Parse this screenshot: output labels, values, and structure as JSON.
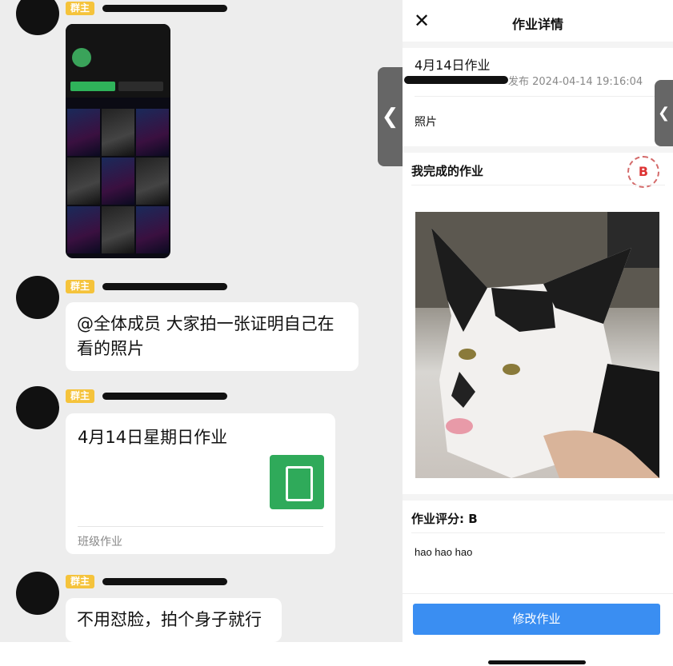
{
  "chat": {
    "tag_label": "群主",
    "message1": "@全体成员 大家拍一张证明自己在看的照片",
    "assignment_card": {
      "title": "4月14日星期日作业",
      "footer": "班级作业"
    },
    "message2": "不用怼脸，拍个身子就行"
  },
  "detail": {
    "nav_title": "作业详情",
    "close_icon": "close-icon",
    "hw_name": "4月14日作业",
    "publish_text": "发布 2024-04-14 19:16:04",
    "photo_label": "照片",
    "my_work_label": "我完成的作业",
    "grade_stamp": "B",
    "score_label": "作业评分: B",
    "comment": "hao hao hao",
    "edit_button": "修改作业"
  },
  "colors": {
    "accent": "#3a8ef2",
    "tag": "#f5c33b",
    "doc_icon": "#2faa5a"
  }
}
